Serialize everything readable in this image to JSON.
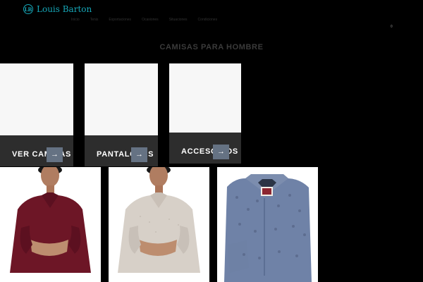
{
  "header": {
    "logo_mark": "LB",
    "brand": "Louis Barton"
  },
  "nav": {
    "items": [
      {
        "label": "Inicio"
      },
      {
        "label": "Tenis"
      },
      {
        "label": "Exportaciones"
      },
      {
        "label": "Ocasiones"
      },
      {
        "label": "Situaciones"
      },
      {
        "label": "Condiciones"
      }
    ]
  },
  "cart": {
    "count": "0"
  },
  "page": {
    "title": "CAMISAS PARA HOMBRE"
  },
  "categories": [
    {
      "label": "VER CAMISAS",
      "icon": "arrow-right-icon"
    },
    {
      "label": "PANTALONES",
      "icon": "arrow-right-icon"
    },
    {
      "label": "ACCESORIOS",
      "icon": "arrow-right-icon"
    }
  ],
  "colors": {
    "brand": "#16a6b7",
    "button": "#657283",
    "card_bar": "#2d2d2d",
    "shirt_maroon": "#6d1626",
    "shirt_beige": "#d7d0c8",
    "shirt_blue": "#6f82a7"
  }
}
